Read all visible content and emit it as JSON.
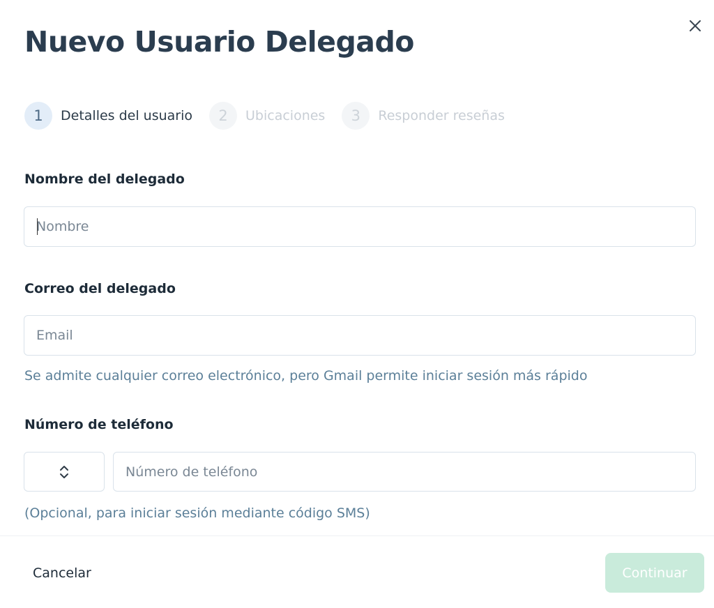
{
  "modal": {
    "title": "Nuevo Usuario Delegado",
    "close_icon": "close-icon"
  },
  "stepper": {
    "steps": [
      {
        "number": "1",
        "label": "Detalles del usuario",
        "state": "active"
      },
      {
        "number": "2",
        "label": "Ubicaciones",
        "state": "inactive"
      },
      {
        "number": "3",
        "label": "Responder reseñas",
        "state": "inactive"
      }
    ]
  },
  "form": {
    "name": {
      "label": "Nombre del delegado",
      "placeholder": "Nombre",
      "value": ""
    },
    "email": {
      "label": "Correo del delegado",
      "placeholder": "Email",
      "value": "",
      "helper": "Se admite cualquier correo electrónico, pero Gmail permite iniciar sesión más rápido"
    },
    "phone": {
      "label": "Número de teléfono",
      "placeholder": "Número de teléfono",
      "value": "",
      "country_selected": "",
      "country_icon": "chevron-up-down-icon",
      "helper": "(Opcional, para iniciar sesión mediante código SMS)"
    }
  },
  "footer": {
    "cancel_label": "Cancelar",
    "continue_label": "Continuar"
  },
  "colors": {
    "title": "#2b3d4f",
    "helper_text": "#5b7f98",
    "continue_disabled_bg": "#c9ebdb",
    "step_active_bg": "#e3edf8",
    "input_border": "#d9e2ea"
  }
}
